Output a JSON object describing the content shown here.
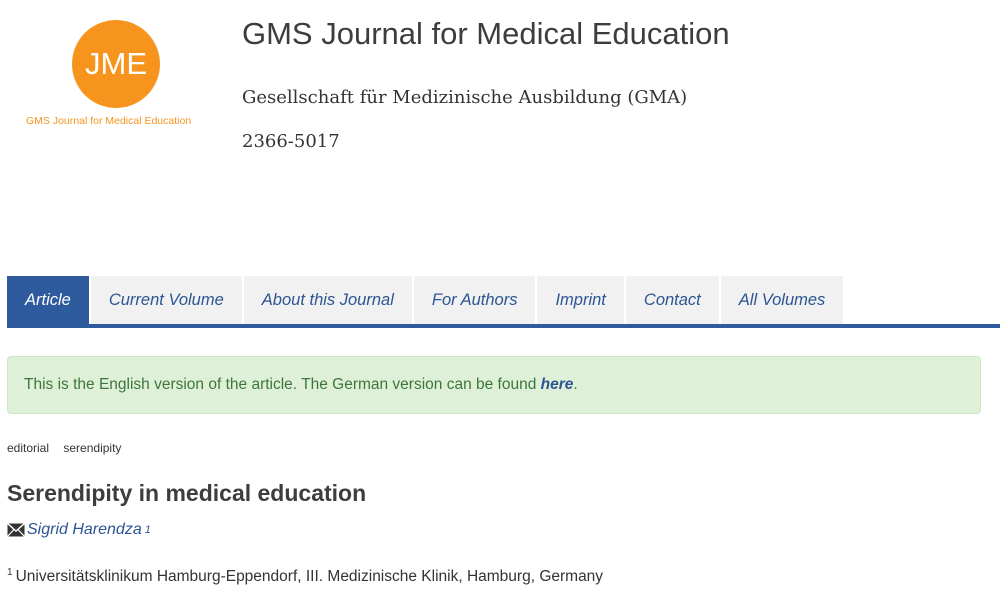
{
  "header": {
    "logo_text": "JME",
    "logo_caption": "GMS Journal for Medical Education",
    "journal_title": "GMS Journal for Medical Education",
    "publisher": "Gesellschaft für Medizinische Ausbildung (GMA)",
    "issn": "2366-5017"
  },
  "nav": {
    "tabs": [
      {
        "label": "Article"
      },
      {
        "label": "Current Volume"
      },
      {
        "label": "About this Journal"
      },
      {
        "label": "For Authors"
      },
      {
        "label": "Imprint"
      },
      {
        "label": "Contact"
      },
      {
        "label": "All Volumes"
      }
    ],
    "active_index": 0
  },
  "alert": {
    "text": "This is the English version of the article. The German version can be found ",
    "link_text": "here",
    "trailing": "."
  },
  "tags": [
    "editorial",
    "serendipity"
  ],
  "article": {
    "title": "Serendipity in medical education",
    "author": "Sigrid Harendza",
    "author_sup": "1",
    "affiliation_sup": "1",
    "affiliation": "Universitätsklinikum Hamburg-Eppendorf, III. Medizinische Klinik, Hamburg, Germany"
  },
  "colors": {
    "brand_orange": "#f7941d",
    "nav_blue": "#2e5a9e",
    "alert_bg": "#dff0d8",
    "alert_text": "#3c763d"
  }
}
